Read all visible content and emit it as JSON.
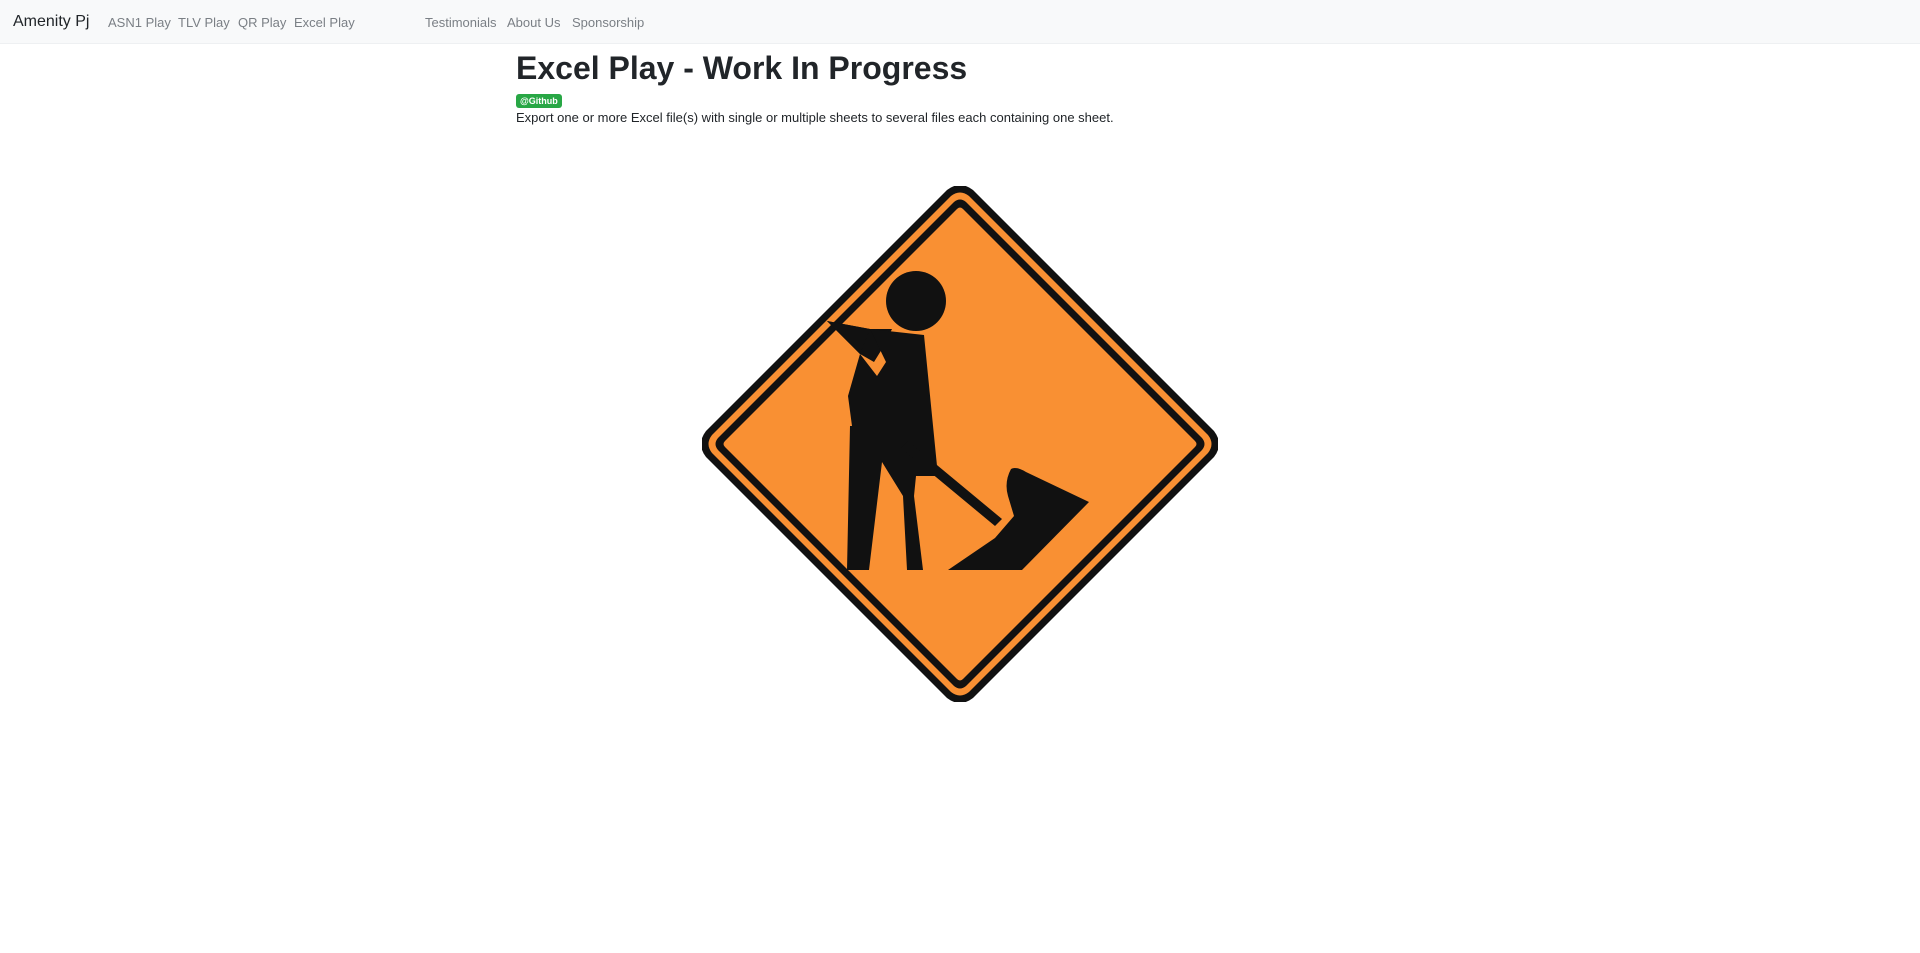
{
  "navbar": {
    "brand": "Amenity Pj",
    "left_links": [
      "ASN1 Play",
      "TLV Play",
      "QR Play",
      "Excel Play"
    ],
    "right_links": [
      "Testimonials",
      "About Us",
      "Sponsorship"
    ]
  },
  "main": {
    "title": "Excel Play - Work In Progress",
    "badge": "@Github",
    "description": "Export one or more Excel file(s) with single or multiple sheets to several files each containing one sheet."
  },
  "sign": {
    "icon": "work-in-progress-sign-icon",
    "fill_color": "#f99033",
    "outline_color": "#111111"
  },
  "colors": {
    "navbar_bg": "#f8f9fa",
    "badge_bg": "#28a745",
    "nav_link": "#7a7f85"
  }
}
